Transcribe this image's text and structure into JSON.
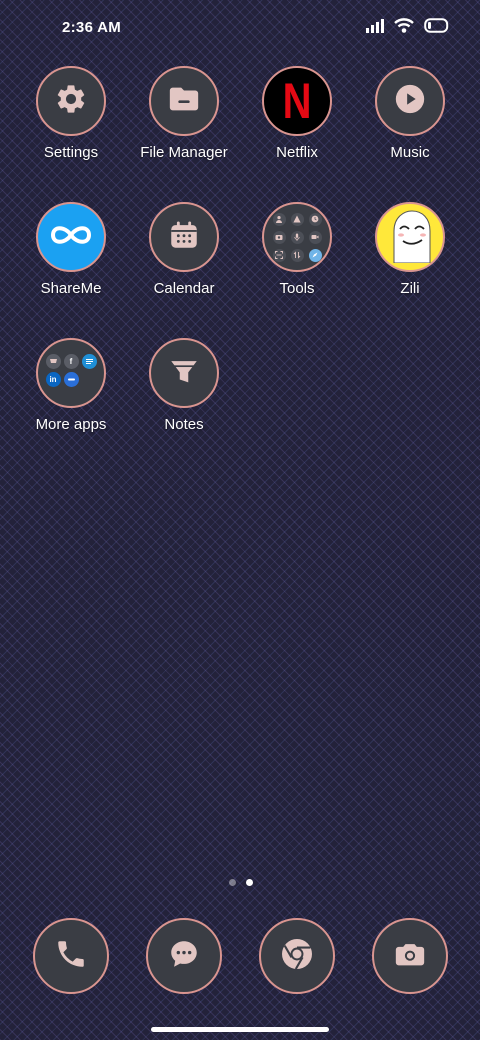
{
  "status_bar": {
    "time": "2:36 AM",
    "icons": [
      "signal-icon",
      "wifi-icon",
      "battery-icon"
    ]
  },
  "apps": [
    {
      "label": "Settings",
      "icon": "gear-icon"
    },
    {
      "label": "File Manager",
      "icon": "folder-icon"
    },
    {
      "label": "Netflix",
      "icon": "netflix-logo"
    },
    {
      "label": "Music",
      "icon": "play-icon"
    },
    {
      "label": "ShareMe",
      "icon": "infinity-icon"
    },
    {
      "label": "Calendar",
      "icon": "calendar-icon"
    },
    {
      "label": "Tools",
      "icon": "tools-folder-icon"
    },
    {
      "label": "Zili",
      "icon": "zili-face-icon"
    },
    {
      "label": "More apps",
      "icon": "more-apps-folder-icon"
    },
    {
      "label": "Notes",
      "icon": "notes-funnel-icon"
    }
  ],
  "netflix": {
    "letter": "N"
  },
  "more_apps_folder": {
    "facebook_letter": "f",
    "linkedin_letter": "in"
  },
  "page_indicator": {
    "pages": 2,
    "current": 2
  },
  "dock": [
    {
      "name": "phone",
      "icon": "phone-icon"
    },
    {
      "name": "messages",
      "icon": "chat-icon"
    },
    {
      "name": "chrome",
      "icon": "chrome-icon"
    },
    {
      "name": "camera",
      "icon": "camera-icon"
    }
  ],
  "colors": {
    "ring": "#d99590",
    "icon_bg": "#3a3d44",
    "glyph": "#e2c6c3",
    "netflix_red": "#e50914",
    "shareme_blue": "#1ba1f2",
    "zili_yellow": "#ffe83a"
  }
}
